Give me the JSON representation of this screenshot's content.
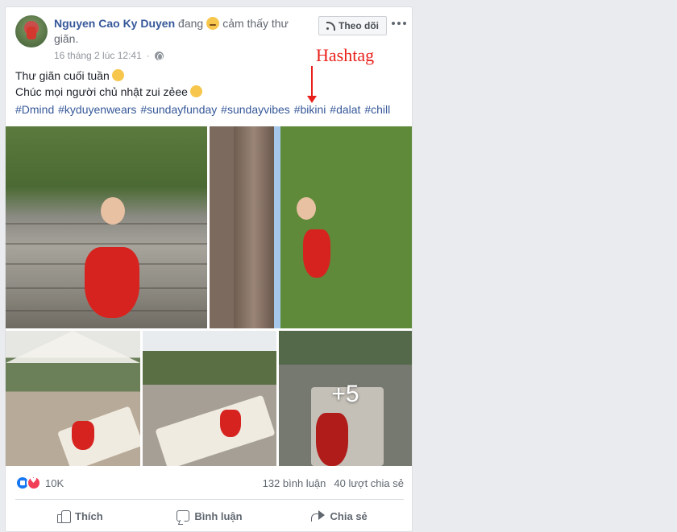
{
  "post": {
    "author": "Nguyen Cao Ky Duyen",
    "feeling_prefix": "đang",
    "feeling": "cảm thấy thư giãn.",
    "timestamp": "16 tháng 2 lúc 12:41",
    "follow_label": "Theo dõi",
    "text_line1": "Thư giãn cuối tuần",
    "text_line2": "Chúc mọi người chủ nhật zui zẻee",
    "hashtags": [
      "#Dmind",
      "#kyduyenwears",
      "#sundayfunday",
      "#sundayvibes",
      "#bikini",
      "#dalat",
      "#chill"
    ],
    "more_photos": "+5"
  },
  "engagement": {
    "reaction_count": "10K",
    "comments": "132 bình luận",
    "shares": "40 lượt chia sẻ"
  },
  "actions": {
    "like": "Thích",
    "comment": "Bình luận",
    "share": "Chia sẻ"
  },
  "annotation": {
    "label": "Hashtag",
    "color": "#e8201b"
  },
  "icons": [
    "globe-icon",
    "rss-icon",
    "more-icon",
    "like-reaction-icon",
    "love-reaction-icon",
    "thumb-icon",
    "comment-icon",
    "share-icon"
  ]
}
